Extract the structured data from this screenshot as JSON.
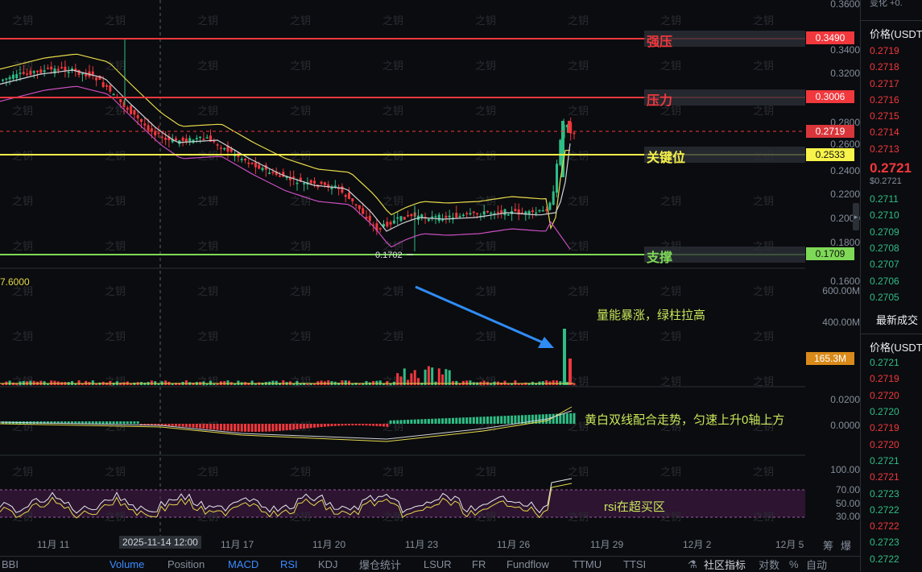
{
  "y_axis_ticks": [
    "0.3600",
    "0.3400",
    "0.3200",
    "0.2800",
    "0.2600",
    "0.2400",
    "0.2200",
    "0.2000",
    "0.1800",
    "0.1600"
  ],
  "levels": {
    "strong_resistance": {
      "label": "强压",
      "price": "0.3490",
      "color": "#f0383d"
    },
    "resistance": {
      "label": "压力",
      "price": "0.3006",
      "color": "#f0383d"
    },
    "current": {
      "price": "0.2719",
      "color": "#f0383d"
    },
    "key": {
      "label": "关键位",
      "price": "0.2533",
      "color": "#f7f34a"
    },
    "support": {
      "label": "支撑",
      "price": "0.1709",
      "color": "#7ed957"
    }
  },
  "low_marker": "0.1702",
  "left_value": "7.6000",
  "volume_axis": [
    "600.00M",
    "400.00M"
  ],
  "volume_tag": "165.3M",
  "macd_axis": [
    "0.0200",
    "0.0000"
  ],
  "rsi_axis": [
    "100.00",
    "70.00",
    "50.00",
    "30.00"
  ],
  "annotations": {
    "volume_note": "量能暴涨，绿柱拉高",
    "macd_note": "黄白双线配合走势，匀速上升0轴上方",
    "rsi_note": "rsi在超买区"
  },
  "x_axis": [
    "11月 11",
    "2025-11-14 12:00",
    "11月 17",
    "11月 20",
    "11月 23",
    "11月 26",
    "11月 29",
    "12月 2",
    "12月 5"
  ],
  "x_axis_extra": [
    "筹",
    "爆"
  ],
  "watermark": "之钥",
  "right_panel": {
    "top_partial": "变化 +0.",
    "orderbook_header": "价格(USDT",
    "asks": [
      "0.2719",
      "0.2718",
      "0.2717",
      "0.2716",
      "0.2715",
      "0.2714",
      "0.2713"
    ],
    "last_price": "0.2721",
    "last_price_sub": "$0.2721",
    "bids": [
      "0.2711",
      "0.2710",
      "0.2709",
      "0.2708",
      "0.2707",
      "0.2706",
      "0.2705"
    ],
    "trades_title": "最新成交",
    "trades_header": "价格(USDT",
    "trades": [
      {
        "p": "0.2721",
        "c": "green"
      },
      {
        "p": "0.2719",
        "c": "red"
      },
      {
        "p": "0.2720",
        "c": "red"
      },
      {
        "p": "0.2720",
        "c": "green"
      },
      {
        "p": "0.2719",
        "c": "red"
      },
      {
        "p": "0.2720",
        "c": "red"
      },
      {
        "p": "0.2721",
        "c": "green"
      },
      {
        "p": "0.2721",
        "c": "red"
      },
      {
        "p": "0.2723",
        "c": "green"
      },
      {
        "p": "0.2722",
        "c": "green"
      },
      {
        "p": "0.2722",
        "c": "red"
      },
      {
        "p": "0.2723",
        "c": "green"
      },
      {
        "p": "0.2722",
        "c": "green"
      }
    ]
  },
  "bottom_tabs": [
    "BBI",
    "Volume",
    "Position",
    "MACD",
    "RSI",
    "KDJ",
    "爆仓统计",
    "LSUR",
    "FR",
    "Fundflow",
    "TTMU",
    "TTSI"
  ],
  "bottom_active": [
    "Volume",
    "MACD",
    "RSI"
  ],
  "bottom_right": [
    "社区指标",
    "对数",
    "%",
    "自动"
  ],
  "colors": {
    "bg": "#0b0c0f",
    "up": "#2ebd85",
    "down": "#f0383d",
    "ma_yellow": "#e6d94a",
    "ma_white": "#cfd3da",
    "ma_pink": "#c84fc0"
  }
}
